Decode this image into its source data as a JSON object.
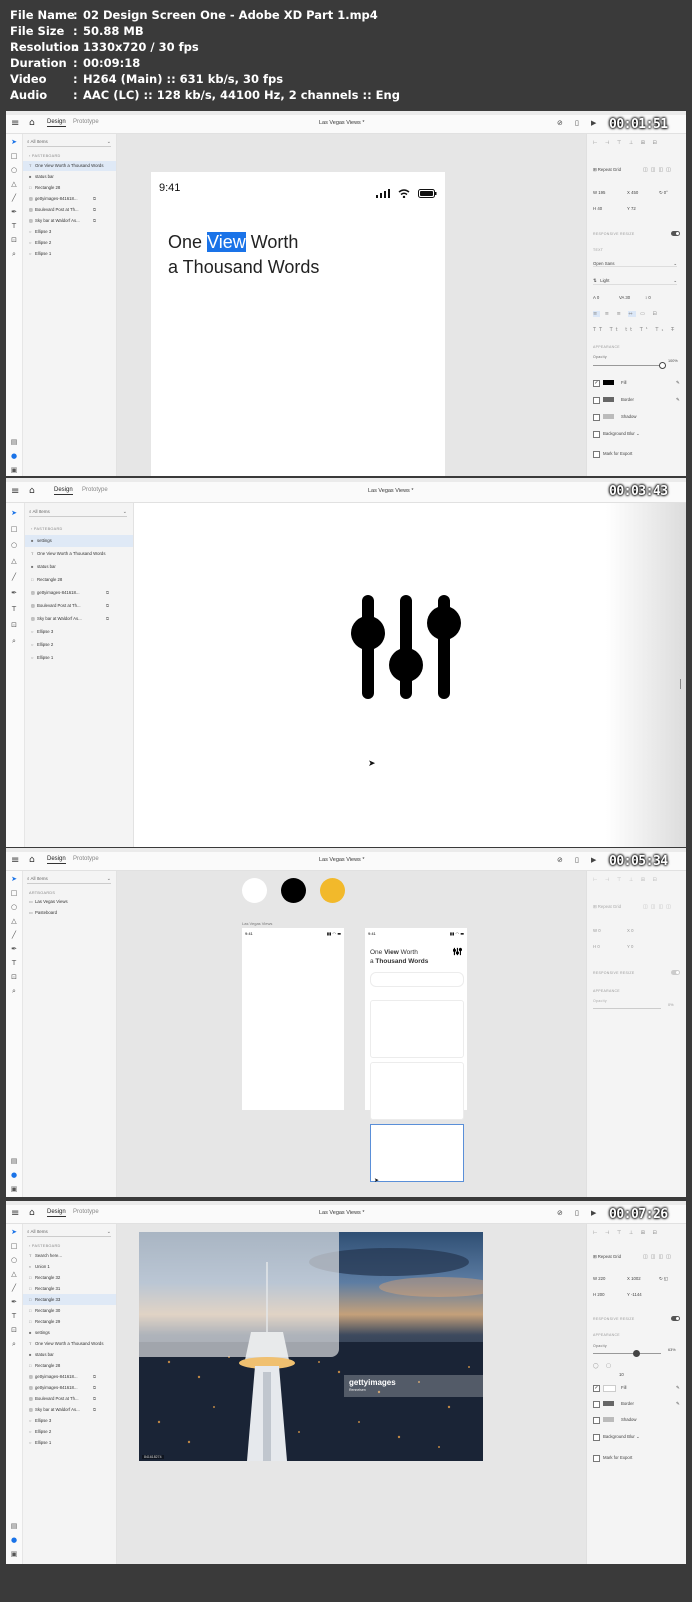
{
  "header": {
    "rows": [
      {
        "key": "File Name",
        "value": "02 Design Screen One - Adobe XD Part 1.mp4"
      },
      {
        "key": "File Size",
        "value": "50.88 MB"
      },
      {
        "key": "Resolution",
        "value": "1330x720 / 30 fps"
      },
      {
        "key": "Duration",
        "value": "00:09:18"
      },
      {
        "key": "Video",
        "value": "H264 (Main) :: 631 kb/s, 30 fps"
      },
      {
        "key": "Audio",
        "value": "AAC (LC) :: 128 kb/s, 44100 Hz, 2 channels :: Eng"
      }
    ],
    "separator": ":"
  },
  "app": {
    "tab_design": "Design",
    "tab_prototype": "Prototype",
    "doc_title": "Las Vegas Views *",
    "search_placeholder": "All Items",
    "menu_icon": "hamburger-icon",
    "home_icon": "home-icon"
  },
  "frames": [
    {
      "timestamp": "00:01:51",
      "layers_header": "PASTEBOARD",
      "layers": [
        "One View Worth a Thousand Words",
        "status bar",
        "Rectangle 28",
        "gettyimages-841618...",
        "Boulevard Post at Th...",
        "Sky bar at Waldorf As...",
        "Ellipse 3",
        "Ellipse 2",
        "Ellipse 1"
      ],
      "selected_layer": 0,
      "phone": {
        "time": "9:41",
        "line1_pre": "One ",
        "line1_highlight": "View",
        "line1_post": " Worth",
        "line2": "a Thousand Words"
      },
      "props": {
        "repeat_grid": "Repeat Grid",
        "w": "195",
        "h": "40",
        "x": "450",
        "y": "72",
        "rotation": "0°",
        "responsive_resize": "RESPONSIVE RESIZE",
        "text_heading": "TEXT",
        "font": "Open Sans",
        "weight": "Light",
        "size": "0",
        "char_spacing": "30",
        "line_spacing": "0",
        "appearance": "APPEARANCE",
        "opacity_label": "Opacity",
        "opacity": "100%",
        "fill": "Fill",
        "border": "Border",
        "shadow": "Shadow",
        "background_blur": "Background Blur",
        "mark_export": "Mark for Export"
      }
    },
    {
      "timestamp": "00:03:43",
      "layers_header": "PASTEBOARD",
      "layers": [
        "settings",
        "One View Worth a Thousand Words",
        "status bar",
        "Rectangle 28",
        "gettyimages-841618...",
        "Boulevard Post at Th...",
        "Sky bar at Waldorf As...",
        "Ellipse 3",
        "Ellipse 2",
        "Ellipse 1"
      ],
      "selected_layer": 0,
      "icon": "sliders-icon"
    },
    {
      "timestamp": "00:05:34",
      "layers_header": "ARTBOARDS",
      "layers": [
        "Las Vegas Views",
        "Pasteboard"
      ],
      "artboard_label": "Las Vegas Views",
      "phone_time": "9:41",
      "title_pre": "One ",
      "title_bold": "View",
      "title_post": " Worth",
      "title2_pre": "a ",
      "title2_bold": "Thousand Words",
      "swatch_colors": [
        "#ffffff",
        "#000000",
        "#f2b92b"
      ],
      "props": {
        "repeat_grid": "Repeat Grid",
        "w": "0",
        "h": "0",
        "x": "0",
        "y": "0",
        "responsive_resize": "RESPONSIVE RESIZE",
        "appearance": "APPEARANCE",
        "opacity_label": "Opacity",
        "opacity": "0%"
      }
    },
    {
      "timestamp": "00:07:26",
      "layers_header": "PASTEBOARD",
      "layers": [
        "Search here...",
        "Union 1",
        "Rectangle 32",
        "Rectangle 31",
        "Rectangle 33",
        "Rectangle 30",
        "Rectangle 29",
        "settings",
        "One View Worth a Thousand Words",
        "status bar",
        "Rectangle 28",
        "gettyimages-841618...",
        "gettyimages-841618...",
        "Boulevard Post at Th...",
        "Sky bar at Waldorf As...",
        "Ellipse 3",
        "Ellipse 2",
        "Ellipse 1"
      ],
      "selected_layer": 4,
      "watermark": "gettyimages",
      "watermark_sub": "Rennelsen",
      "image_id": "841618274",
      "props": {
        "repeat_grid": "Repeat Grid",
        "w": "220",
        "h": "200",
        "x": "1002",
        "y": "-1144",
        "responsive_resize": "RESPONSIVE RESIZE",
        "appearance": "APPEARANCE",
        "opacity_label": "Opacity",
        "opacity": "63%",
        "opacity_value": 0.63,
        "radius": "10",
        "fill": "Fill",
        "border": "Border",
        "shadow": "Shadow",
        "background_blur": "Background Blur",
        "mark_export": "Mark for Export"
      }
    }
  ],
  "colors": {
    "selection_blue": "#1a73e8",
    "layer_selected": "#dfe9f6",
    "accent_yellow": "#f2b92b"
  }
}
